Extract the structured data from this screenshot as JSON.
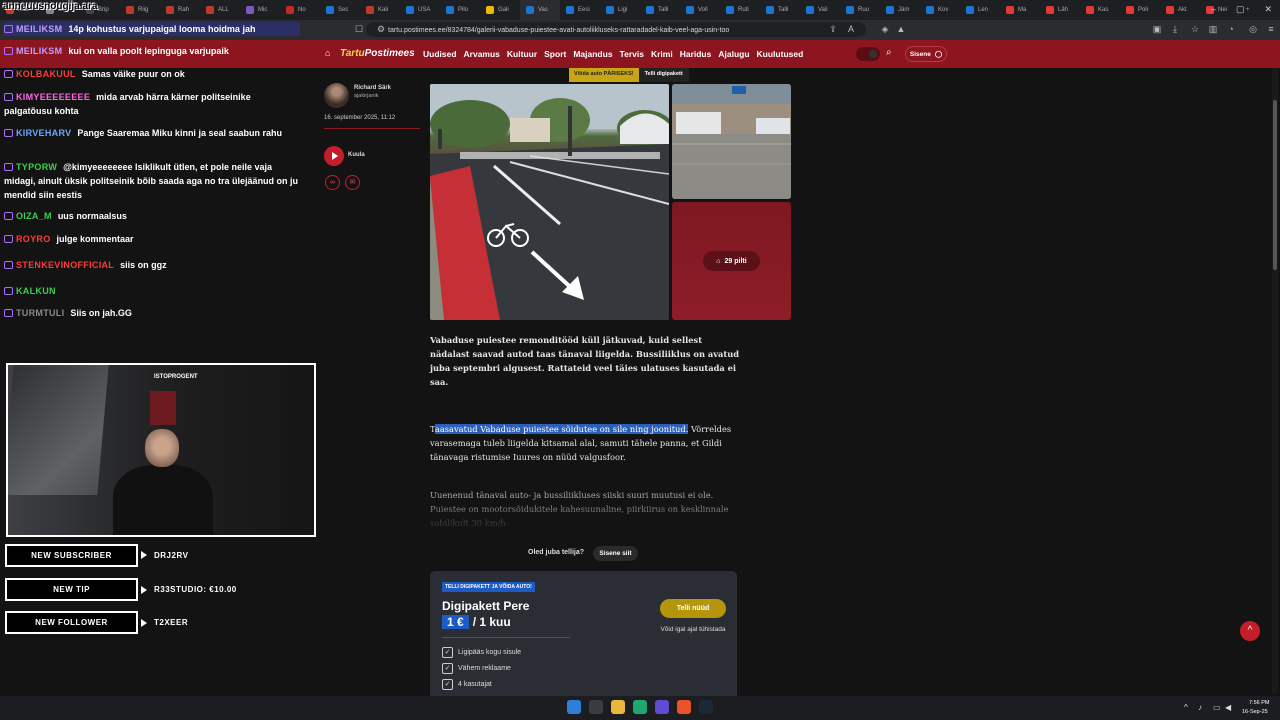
{
  "browser": {
    "tabs": [
      {
        "label": "Kaa",
        "color": "#c0392b"
      },
      {
        "label": "xM",
        "color": "#888888"
      },
      {
        "label": "Brip",
        "color": "#444444"
      },
      {
        "label": "Riig",
        "color": "#c0392b"
      },
      {
        "label": "Rah",
        "color": "#c0392b"
      },
      {
        "label": "ALL",
        "color": "#c0392b"
      },
      {
        "label": "Mic",
        "color": "#7e57c2"
      },
      {
        "label": "No",
        "color": "#c62828"
      },
      {
        "label": "Sec",
        "color": "#1976d2"
      },
      {
        "label": "Kali",
        "color": "#c0392b"
      },
      {
        "label": "USA",
        "color": "#1976d2"
      },
      {
        "label": "Pilo",
        "color": "#1976d2"
      },
      {
        "label": "Gali",
        "color": "#f2b705"
      },
      {
        "label": "Vas",
        "color": "#1976d2"
      },
      {
        "label": "Eesi",
        "color": "#1976d2"
      },
      {
        "label": "Ligi",
        "color": "#1976d2"
      },
      {
        "label": "Talli",
        "color": "#1976d2"
      },
      {
        "label": "Voll",
        "color": "#1976d2"
      },
      {
        "label": "Ruti",
        "color": "#1976d2"
      },
      {
        "label": "Talli",
        "color": "#1976d2"
      },
      {
        "label": "Vali",
        "color": "#1976d2"
      },
      {
        "label": "Ruu",
        "color": "#1976d2"
      },
      {
        "label": "Jäm",
        "color": "#1976d2"
      },
      {
        "label": "Kov",
        "color": "#1976d2"
      },
      {
        "label": "Len",
        "color": "#1976d2"
      },
      {
        "label": "Ma",
        "color": "#e53935"
      },
      {
        "label": "Läh",
        "color": "#e53935"
      },
      {
        "label": "Kas",
        "color": "#e53935"
      },
      {
        "label": "Poli",
        "color": "#e53935"
      },
      {
        "label": "Akt",
        "color": "#e53935"
      },
      {
        "label": "Nei",
        "color": "#e53935"
      }
    ],
    "url": "tartu.postimees.ee/8324784/galerii-vabaduse-puiestee-avati-autoliikluseks-rattaradadel-kaib-veel-aga-usin-too"
  },
  "site": {
    "logo_prefix": "Tartu",
    "logo_main": "Postimees",
    "nav": [
      "Uudised",
      "Arvamus",
      "Kultuur",
      "Sport",
      "Majandus",
      "Tervis",
      "Krimi",
      "Haridus",
      "Ajalugu",
      "Kuulutused"
    ],
    "login_label": "Sisene",
    "promo_left": "Võida auto PÄRISEKS!",
    "promo_right": "Telli digipakett"
  },
  "article": {
    "author_name": "Richard Särk",
    "author_role": "ajakirjanik",
    "date": "16. september 2025, 11:12",
    "listen_label": "Kuula",
    "gallery_count": "29 pilti",
    "lead": "Vabaduse puiestee remonditööd küll jätkuvad, kuid sellest nädalast saavad autod taas tänaval liigelda. Bussiliiklus on avatud juba septembri algusest. Rattateid veel täies ulatuses kasutada ei saa.",
    "para1_first": "T",
    "para1_highlight": "aasavatud Vabaduse puiestee sõidutee on sile ning joonitud.",
    "para1_rest": " Võrreldes varasemaga tuleb liigelda kitsamal alal, samuti tähele panna, et Gildi tänavaga ristumise ",
    "para1_cursor": "I",
    "para1_end": "uures on nüüd valgusfoor.",
    "para2": "Uuenenud tänaval auto- ja bussiliikluses siiski suuri muutusi ei ole. Puiestee on mootorsõidukitele kahesuunaline, piirkiirus on kesklinnale sobilikult 30 km/h."
  },
  "subscribe": {
    "question": "Oled juba tellija?",
    "login": "Sisene siit",
    "badge": "TELLI DIGIPAKETT JA VÕIDA AUTO!",
    "title": "Digipakett Pere",
    "price_big": "1 €",
    "price_per": "/ 1 kuu",
    "order_button": "Telli nüüd",
    "cancel_note": "Võid igal ajal tühistada",
    "features": [
      "Ligipääs kogu sisule",
      "Vähem reklaame",
      "4 kasutajat"
    ]
  },
  "overlay": {
    "title": "anneuusnougija.ara",
    "chat": [
      {
        "user": "MEILIKSM",
        "user_color": "#c29cff",
        "text": "14p kohustus varjupaigal looma hoidma jah"
      },
      {
        "user": "MEILIKSM",
        "user_color": "#c29cff",
        "text": "kui on valla poolt lepinguga varjupaik"
      },
      {
        "user": "KOLBAKUUL",
        "user_color": "#ff3a3a",
        "text": "Samas väike puur on ok"
      },
      {
        "user": "KIMYEEEEEEEE",
        "user_color": "#ff66e0",
        "text": "mida arvab härra kärner politseinike palgatõusu kohta"
      },
      {
        "user": "KIRVEHARV",
        "user_color": "#6aa7ff",
        "text": "Pange Saaremaa Miku kinni ja seal saabun rahu"
      },
      {
        "user": "TYPORW",
        "user_color": "#3ccf4e",
        "text": "@kimyeeeeeeee lsiklikult ütlen, et pole neile vaja midagi, ainult üksik politseinik bõib saada aga no tra ülejäänud on ju mendid siin eestis"
      },
      {
        "user": "OIZA_M",
        "user_color": "#3ccf4e",
        "text": "uus normaalsus"
      },
      {
        "user": "ROYRO",
        "user_color": "#ff3a3a",
        "text": "julge kommentaar"
      },
      {
        "user": "STENKEVINOFFICIAL",
        "user_color": "#ff3a3a",
        "text": "siis on ggz"
      },
      {
        "user": "KALKUN",
        "user_color": "#3ccf4e",
        "text": ""
      },
      {
        "user": "TURMTULI",
        "user_color": "#8a8a8a",
        "text": "Siis on jah.GG"
      }
    ],
    "cam_shirt_label": "ISTOPROGENT",
    "events": [
      {
        "label": "NEW SUBSCRIBER",
        "value": "DRJ2RV"
      },
      {
        "label": "NEW TIP",
        "value": "R33STUDIO: €10.00"
      },
      {
        "label": "NEW FOLLOWER",
        "value": "T2XEER"
      }
    ]
  },
  "taskbar": {
    "time": "7:56 PM",
    "date": "16-Sep-25"
  }
}
